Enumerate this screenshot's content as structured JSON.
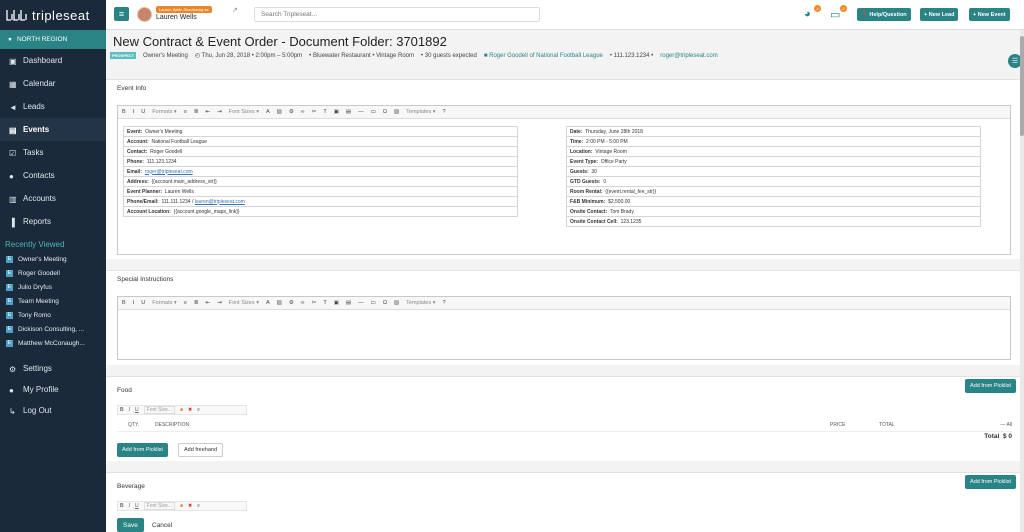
{
  "app": {
    "logo": "tripleseat",
    "region": "NORTH REGION"
  },
  "sidebar": {
    "nav": [
      {
        "label": "Dashboard",
        "icon": "dashboard-icon"
      },
      {
        "label": "Calendar",
        "icon": "calendar-icon"
      },
      {
        "label": "Leads",
        "icon": "megaphone-icon"
      },
      {
        "label": "Events",
        "icon": "book-icon",
        "active": true
      },
      {
        "label": "Tasks",
        "icon": "tasks-icon"
      },
      {
        "label": "Contacts",
        "icon": "contacts-icon"
      },
      {
        "label": "Accounts",
        "icon": "building-icon"
      },
      {
        "label": "Reports",
        "icon": "bar-chart-icon"
      }
    ],
    "recent_heading": "Recently Viewed",
    "recent": [
      "Owner's Meeting",
      "Roger Goodell",
      "Julio Dryfus",
      "Team Meeting",
      "Tony Romo",
      "Dickison Consulting, ...",
      "Matthew McConaugh..."
    ],
    "footer": [
      "Settings",
      "My Profile",
      "Log Out"
    ]
  },
  "topbar": {
    "shadowing": "Lauren Wells Shadowing as",
    "user": "Lauren Wells",
    "search_placeholder": "Search Tripleseat...",
    "badge1": "4",
    "badge2": "2",
    "help": "Help/Question",
    "new_lead": "New Lead",
    "new_event": "New Event"
  },
  "page": {
    "title": "New Contract & Event Order - Document Folder: 3701892",
    "status": "PROSPECT",
    "event_name": "Owner's Meeting",
    "datetime": "Thu, Jun 28, 2018 • 2:00pm – 5:00pm",
    "location": "Bluewater Restaurant • Vintage Room",
    "guests": "30 guests expected",
    "contact": "Roger Goodell of National Football League",
    "phone": "111.123.1234",
    "email": "roger@tripleseat.com"
  },
  "toolbar": {
    "formats": "Formats",
    "font_sizes": "Font Sizes",
    "templates": "Templates"
  },
  "event_info": {
    "heading": "Event Info",
    "left": [
      {
        "k": "Event:",
        "v": "Owner's Meeting"
      },
      {
        "k": "Account:",
        "v": "National Football League"
      },
      {
        "k": "Contact:",
        "v": "Roger Goodell"
      },
      {
        "k": "Phone:",
        "v": "111.123.1234"
      },
      {
        "k": "Email:",
        "v": "roger@tripleseat.com"
      },
      {
        "k": "Address:",
        "v": "{{account.main_address_str}}"
      },
      {
        "k": "Event Planner:",
        "v": "Lauren Wells"
      },
      {
        "k": "Phone/Email:",
        "v": "111.111.1234 / ",
        "v2": "lauren@tripleseat.com"
      },
      {
        "k": "Account Location:",
        "v": "{{account.google_maps_link}}"
      }
    ],
    "right": [
      {
        "k": "Date:",
        "v": "Thursday, June 28th 2018"
      },
      {
        "k": "Time:",
        "v": "2:00 PM - 5:00 PM"
      },
      {
        "k": "Location:",
        "v": "Vintage Room"
      },
      {
        "k": "Event Type:",
        "v": "Office Party"
      },
      {
        "k": "Guests:",
        "v": "30"
      },
      {
        "k": "GTD Guests:",
        "v": "0"
      },
      {
        "k": "Room Rental:",
        "v": "{{event.rental_fee_str}}"
      },
      {
        "k": "F&B Minimum:",
        "v": "$2,500.00"
      },
      {
        "k": "Onsite Contact:",
        "v": "Tom Brady"
      },
      {
        "k": "Onsite Contact Cell:",
        "v": "123.1235"
      }
    ]
  },
  "special": {
    "heading": "Special Instructions"
  },
  "food": {
    "heading": "Food",
    "add_picklist": "Add from Picklist",
    "font_size": "Font Size...",
    "cols": {
      "qty": "QTY.",
      "desc": "DESCRIPTION",
      "price": "PRICE",
      "total": "TOTAL",
      "all": "— All"
    },
    "total_label": "Total",
    "total_value": "$ 0",
    "add_from_picklist": "Add from Picklist",
    "add_freehand": "Add freehand"
  },
  "beverage": {
    "heading": "Beverage",
    "add_picklist": "Add from Picklist",
    "font_size": "Font Size..."
  },
  "actions": {
    "save": "Save",
    "cancel": "Cancel"
  },
  "colors": {
    "teal": "#2a8486",
    "sidebar": "#1b2a3a",
    "accent": "#f08a24"
  }
}
